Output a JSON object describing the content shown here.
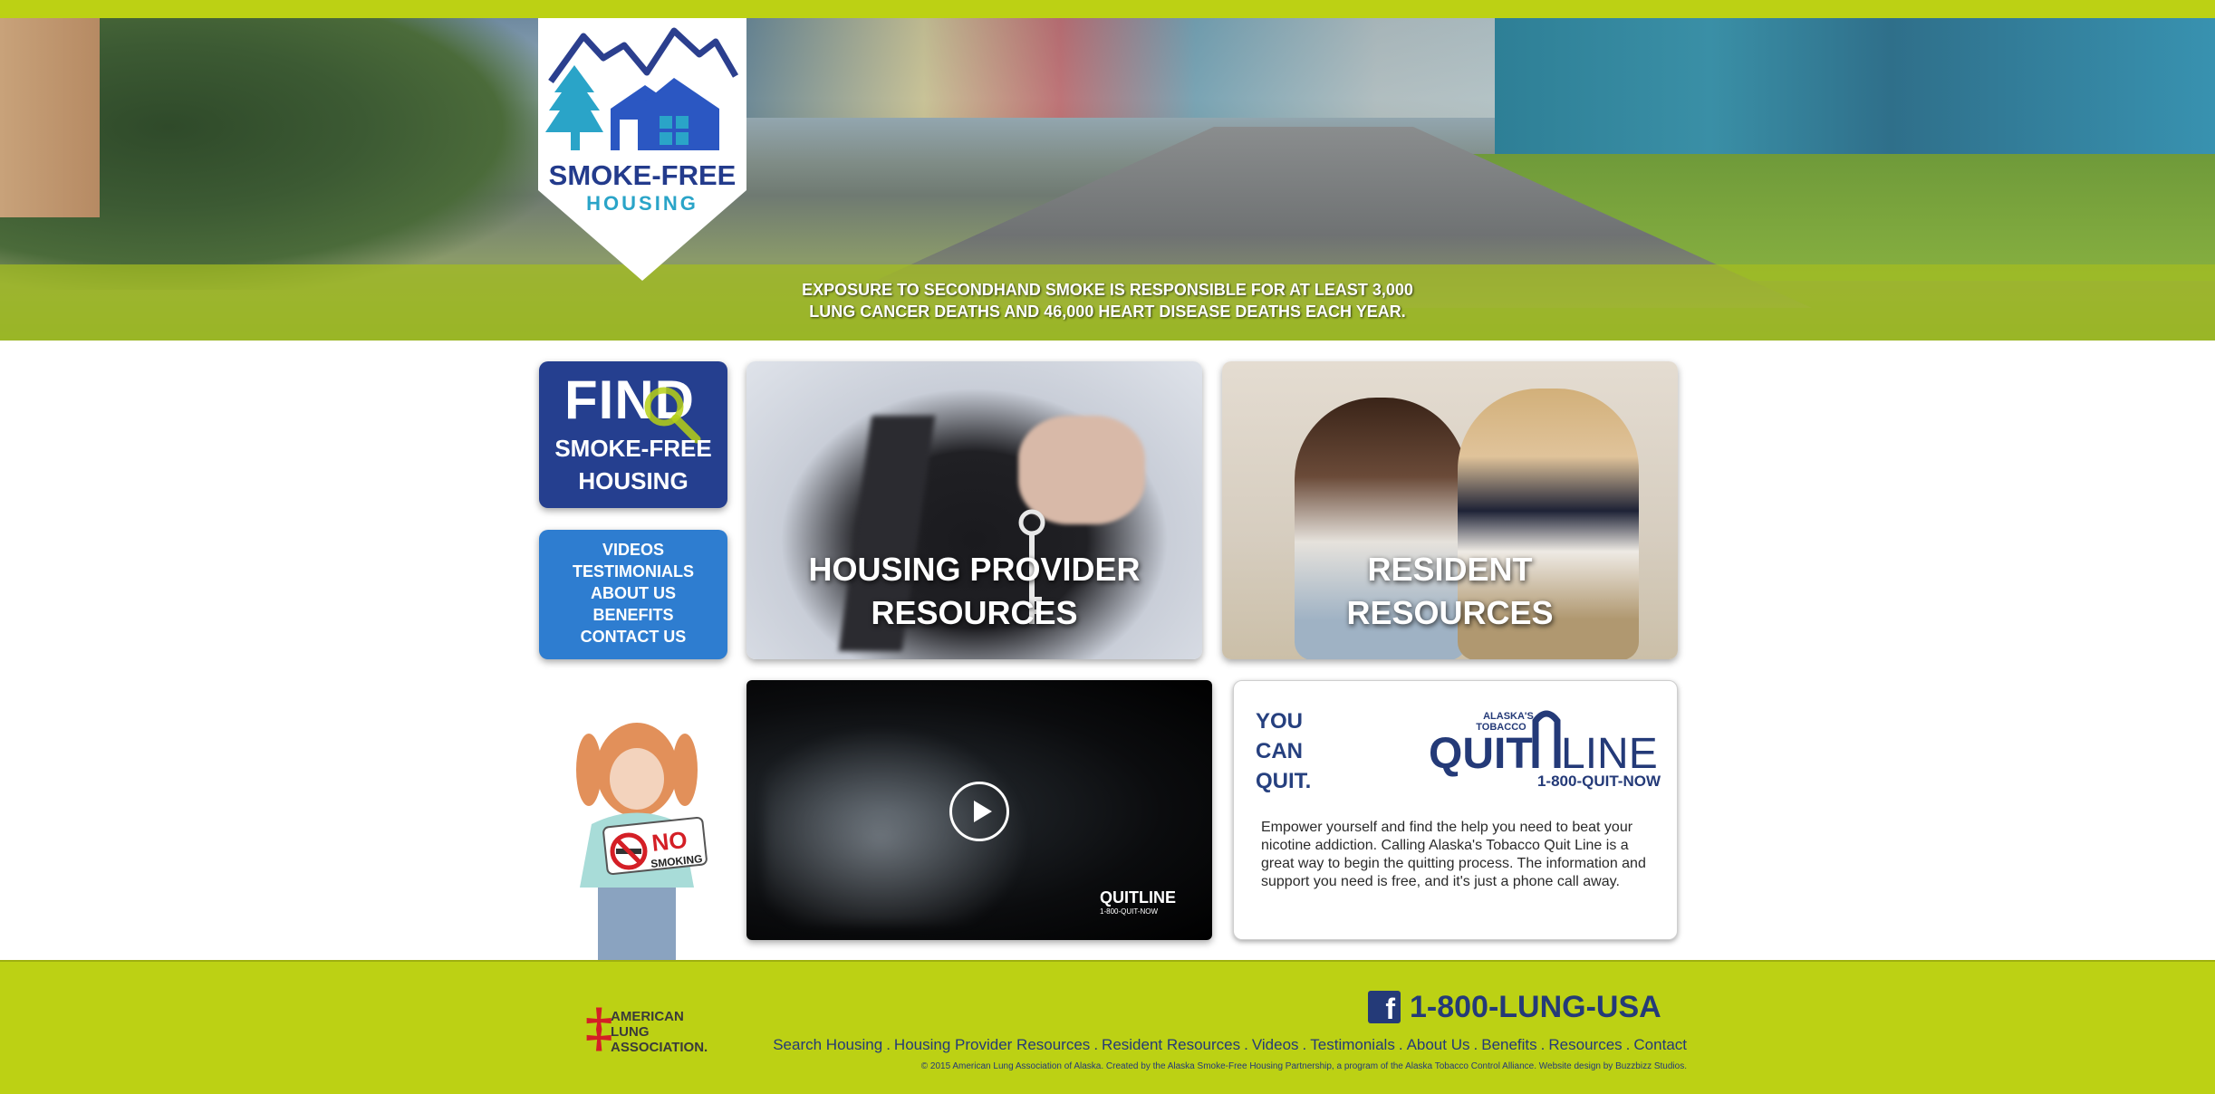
{
  "hero": {
    "tagline_line1": "EXPOSURE TO SECONDHAND SMOKE IS RESPONSIBLE FOR AT LEAST 3,000",
    "tagline_line2": "LUNG CANCER DEATHS AND 46,000 HEART DISEASE DEATHS EACH YEAR."
  },
  "logo": {
    "line1": "SMOKE-FREE",
    "line2": "HOUSING",
    "icon": "mountains-trees-house-icon"
  },
  "find_tile": {
    "big": "FIND",
    "line1": "SMOKE-FREE",
    "line2": "HOUSING",
    "icon": "magnifier-icon"
  },
  "nav": {
    "items": [
      "VIDEOS",
      "TESTIMONIALS",
      "ABOUT US",
      "BENEFITS",
      "CONTACT US"
    ]
  },
  "housing_provider": {
    "line1": "HOUSING PROVIDER",
    "line2": "RESOURCES"
  },
  "resident": {
    "line1": "RESIDENT",
    "line2": "RESOURCES"
  },
  "girl_sign": {
    "no": "NO",
    "smoking": "SMOKING",
    "icon": "no-smoking-icon"
  },
  "video": {
    "watermark": "QUITLINE",
    "watermark_sub": "1-800-QUIT-NOW",
    "icon": "play-icon"
  },
  "quitline": {
    "you": "YOU",
    "can": "CAN",
    "quit": "QUIT.",
    "brand_top1": "ALASKA'S",
    "brand_top2": "TOBACCO",
    "brand_quit": "QUIT",
    "brand_line": "LINE",
    "brand_phone": "1-800-QUIT-NOW",
    "body": "Empower yourself and find the help you need to beat your nicotine addiction. Calling Alaska's Tobacco Quit Line is a great way to begin the quitting process. The information and support you need is free, and it's just a phone call away."
  },
  "footer": {
    "ala_name": [
      "AMERICAN",
      "LUNG",
      "ASSOCIATION."
    ],
    "phone": "1-800-LUNG-USA",
    "fb_icon": "facebook-icon",
    "links": [
      "Search Housing",
      "Housing Provider Resources",
      "Resident Resources",
      "Videos",
      "Testimonials",
      "About Us",
      "Benefits",
      "Resources",
      "Contact"
    ],
    "copyright": "© 2015 American Lung Association of Alaska. Created by the Alaska Smoke-Free Housing Partnership, a program of the Alaska Tobacco Control Alliance. Website design by Buzzbizz Studios."
  },
  "colors": {
    "lime": "#bcd114",
    "navy": "#243a78",
    "blue": "#2e7dd0",
    "dark_blue": "#253f8f",
    "red": "#d41f26"
  }
}
